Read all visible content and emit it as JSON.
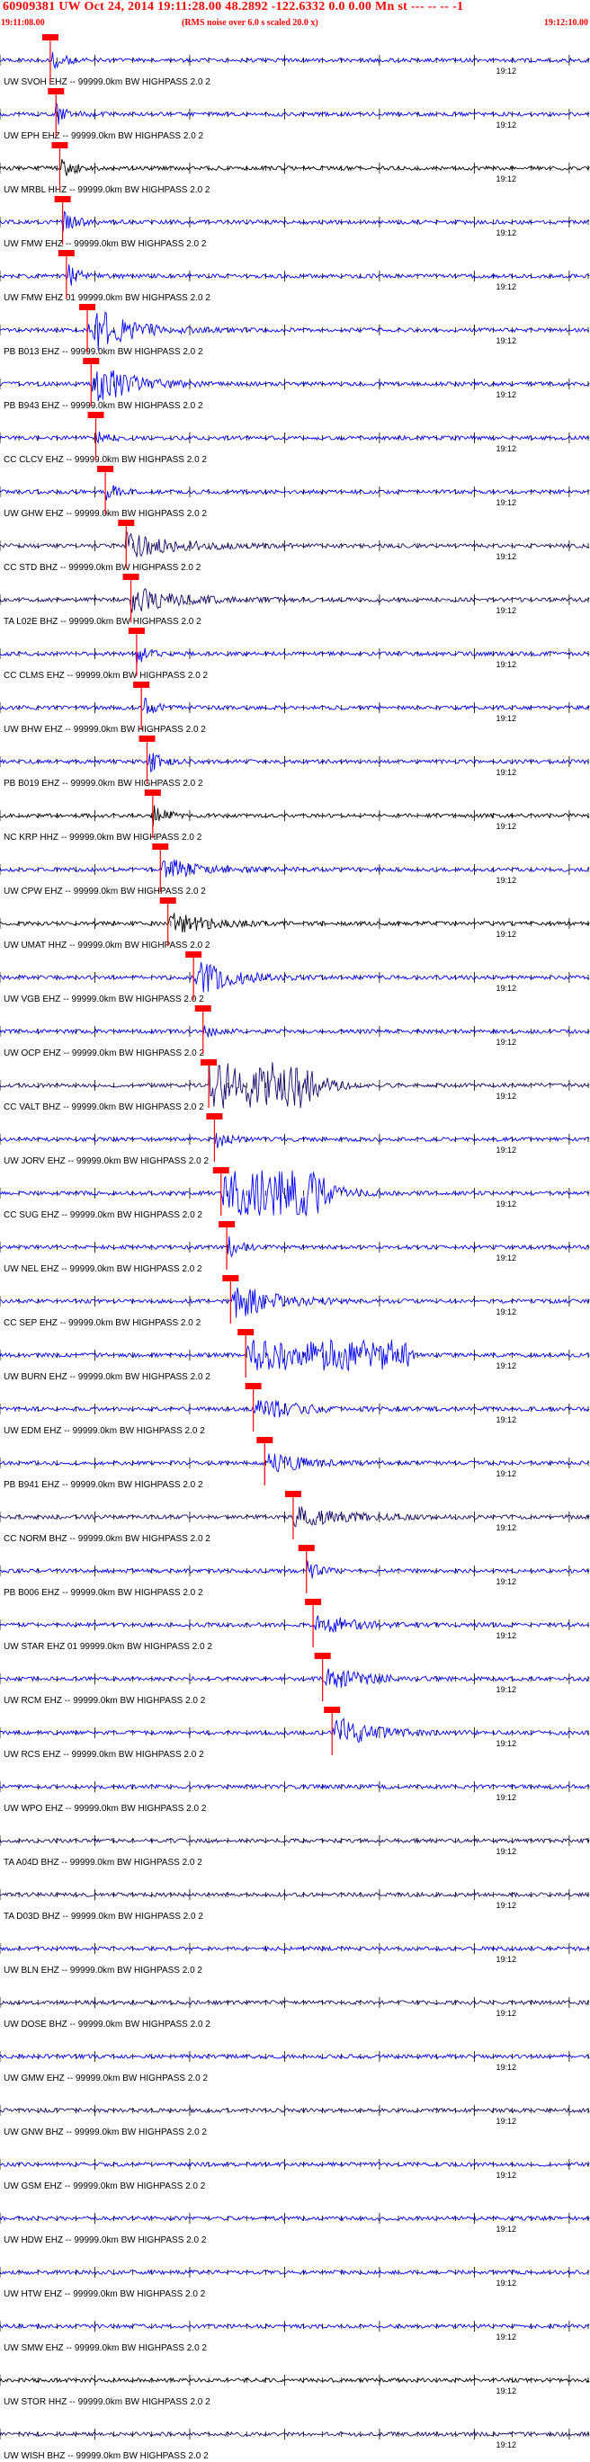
{
  "header": {
    "title": "60909381 UW Oct 24, 2014 19:11:28.00   48.2892  -122.6332  0.0 0.00 Mn st --- -- --  -1",
    "start_time": "19:11:08.00",
    "note": "(RMS noise over 6.0 s scaled 20.0 x)",
    "end_time": "19:12:10.00",
    "color": "#ff0000"
  },
  "chart_data": {
    "type": "seismogram-record-section",
    "time_range_s": [
      0,
      62
    ],
    "minute_tick_label": "19:12",
    "minute_tick_time_s": 52,
    "colors": {
      "trace_blue": "#0000ff",
      "trace_black": "#000000",
      "trace_navy": "#1a0a6e",
      "pick": "#ff0000",
      "tick": "#000000"
    },
    "traces": [
      {
        "label": "UW SVOH EHZ -- 99999.0km BW  HIGHPASS  2.0  2",
        "pick_s": 5.3,
        "color": "trace_blue",
        "amp": 1.5,
        "env": "pulse"
      },
      {
        "label": "UW EPH EHZ -- 99999.0km BW  HIGHPASS  2.0  2",
        "pick_s": 5.9,
        "color": "trace_blue",
        "amp": 1.3,
        "env": "pulse"
      },
      {
        "label": "UW MRBL HHZ -- 99999.0km BW  HIGHPASS  2.0  2",
        "pick_s": 6.3,
        "color": "trace_black",
        "amp": 1.6,
        "env": "pulse"
      },
      {
        "label": "UW FMW EHZ -- 99999.0km BW  HIGHPASS  2.0  2",
        "pick_s": 6.6,
        "color": "trace_blue",
        "amp": 1.4,
        "env": "pulse"
      },
      {
        "label": "UW FMW EHZ 01 99999.0km BW  HIGHPASS  2.0  2",
        "pick_s": 7.0,
        "color": "trace_blue",
        "amp": 1.5,
        "env": "pulse"
      },
      {
        "label": "PB B013 EHZ -- 99999.0km BW  HIGHPASS  2.0  2",
        "pick_s": 9.2,
        "color": "trace_blue",
        "amp": 3.5,
        "env": "burst"
      },
      {
        "label": "PB B943 EHZ -- 99999.0km BW  HIGHPASS  2.0  2",
        "pick_s": 9.6,
        "color": "trace_blue",
        "amp": 3.2,
        "env": "burst"
      },
      {
        "label": "CC CLCV EHZ -- 99999.0km BW  HIGHPASS  2.0  2",
        "pick_s": 10.1,
        "color": "trace_blue",
        "amp": 1.1,
        "env": "pulse"
      },
      {
        "label": "UW GHW EHZ -- 99999.0km BW  HIGHPASS  2.0  2",
        "pick_s": 11.1,
        "color": "trace_blue",
        "amp": 1.2,
        "env": "pulse"
      },
      {
        "label": "CC STD BHZ -- 99999.0km BW  HIGHPASS  2.0  2",
        "pick_s": 13.3,
        "color": "trace_navy",
        "amp": 2.0,
        "env": "coda"
      },
      {
        "label": "TA L02E BHZ -- 99999.0km BW  HIGHPASS  2.0  2",
        "pick_s": 13.8,
        "color": "trace_navy",
        "amp": 2.0,
        "env": "coda"
      },
      {
        "label": "CC CLMS EHZ -- 99999.0km BW  HIGHPASS  2.0  2",
        "pick_s": 14.4,
        "color": "trace_blue",
        "amp": 1.2,
        "env": "pulse"
      },
      {
        "label": "UW BHW EHZ -- 99999.0km BW  HIGHPASS  2.0  2",
        "pick_s": 14.9,
        "color": "trace_blue",
        "amp": 1.4,
        "env": "pulse"
      },
      {
        "label": "PB B019 EHZ -- 99999.0km BW  HIGHPASS  2.0  2",
        "pick_s": 15.5,
        "color": "trace_blue",
        "amp": 1.6,
        "env": "pulse"
      },
      {
        "label": "NC KRP HHZ -- 99999.0km BW  HIGHPASS  2.0  2",
        "pick_s": 16.1,
        "color": "trace_black",
        "amp": 1.4,
        "env": "pulse"
      },
      {
        "label": "UW CPW EHZ -- 99999.0km BW  HIGHPASS  2.0  2",
        "pick_s": 16.9,
        "color": "trace_blue",
        "amp": 1.6,
        "env": "burst"
      },
      {
        "label": "UW UMAT HHZ -- 99999.0km BW  HIGHPASS  2.0  2",
        "pick_s": 17.7,
        "color": "trace_black",
        "amp": 1.5,
        "env": "burst"
      },
      {
        "label": "UW VGB EHZ -- 99999.0km BW  HIGHPASS  2.0  2",
        "pick_s": 20.4,
        "color": "trace_blue",
        "amp": 2.4,
        "env": "burst"
      },
      {
        "label": "UW OCP EHZ -- 99999.0km BW  HIGHPASS  2.0  2",
        "pick_s": 21.4,
        "color": "trace_blue",
        "amp": 1.3,
        "env": "pulse"
      },
      {
        "label": "CC VALT BHZ -- 99999.0km BW  HIGHPASS  2.0  2",
        "pick_s": 22.0,
        "color": "trace_navy",
        "amp": 5.0,
        "env": "block"
      },
      {
        "label": "UW JORV EHZ -- 99999.0km BW  HIGHPASS  2.0  2",
        "pick_s": 22.6,
        "color": "trace_blue",
        "amp": 1.3,
        "env": "pulse"
      },
      {
        "label": "CC SUG EHZ -- 99999.0km BW  HIGHPASS  2.0  2",
        "pick_s": 23.3,
        "color": "trace_blue",
        "amp": 5.0,
        "env": "block"
      },
      {
        "label": "UW NEL EHZ -- 99999.0km BW  HIGHPASS  2.0  2",
        "pick_s": 23.9,
        "color": "trace_blue",
        "amp": 1.4,
        "env": "pulse"
      },
      {
        "label": "CC SEP EHZ -- 99999.0km BW  HIGHPASS  2.0  2",
        "pick_s": 24.3,
        "color": "trace_blue",
        "amp": 3.0,
        "env": "burst"
      },
      {
        "label": "UW BURN EHZ -- 99999.0km BW  HIGHPASS  2.0  2",
        "pick_s": 25.9,
        "color": "trace_blue",
        "amp": 6.5,
        "env": "saturated"
      },
      {
        "label": "UW EDM EHZ -- 99999.0km BW  HIGHPASS  2.0  2",
        "pick_s": 26.7,
        "color": "trace_blue",
        "amp": 1.8,
        "env": "burst"
      },
      {
        "label": "PB B941 EHZ -- 99999.0km BW  HIGHPASS  2.0  2",
        "pick_s": 27.9,
        "color": "trace_blue",
        "amp": 1.5,
        "env": "burst"
      },
      {
        "label": "CC NORM BHZ -- 99999.0km BW  HIGHPASS  2.0  2",
        "pick_s": 30.9,
        "color": "trace_navy",
        "amp": 1.6,
        "env": "coda"
      },
      {
        "label": "PB B006 EHZ -- 99999.0km BW  HIGHPASS  2.0  2",
        "pick_s": 32.3,
        "color": "trace_blue",
        "amp": 1.4,
        "env": "pulse"
      },
      {
        "label": "UW STAR EHZ 01 99999.0km BW  HIGHPASS  2.0  2",
        "pick_s": 33.0,
        "color": "trace_blue",
        "amp": 1.5,
        "env": "burst"
      },
      {
        "label": "UW RCM EHZ -- 99999.0km BW  HIGHPASS  2.0  2",
        "pick_s": 34.0,
        "color": "trace_blue",
        "amp": 1.8,
        "env": "burst"
      },
      {
        "label": "UW RCS EHZ -- 99999.0km BW  HIGHPASS  2.0  2",
        "pick_s": 35.0,
        "color": "trace_blue",
        "amp": 2.2,
        "env": "burst"
      },
      {
        "label": "UW WPO EHZ -- 99999.0km BW  HIGHPASS  2.0  2",
        "pick_s": null,
        "color": "trace_blue",
        "amp": 1.0,
        "env": "noise"
      },
      {
        "label": "TA A04D BHZ -- 99999.0km BW  HIGHPASS  2.0  2",
        "pick_s": null,
        "color": "trace_navy",
        "amp": 1.0,
        "env": "noise"
      },
      {
        "label": "TA D03D BHZ -- 99999.0km BW  HIGHPASS  2.0  2",
        "pick_s": null,
        "color": "trace_navy",
        "amp": 1.0,
        "env": "noise"
      },
      {
        "label": "UW BLN EHZ -- 99999.0km BW  HIGHPASS  2.0  2",
        "pick_s": null,
        "color": "trace_blue",
        "amp": 1.0,
        "env": "noise"
      },
      {
        "label": "UW DOSE BHZ -- 99999.0km BW  HIGHPASS  2.0  2",
        "pick_s": null,
        "color": "trace_navy",
        "amp": 1.0,
        "env": "noise"
      },
      {
        "label": "UW GMW EHZ -- 99999.0km BW  HIGHPASS  2.0  2",
        "pick_s": null,
        "color": "trace_blue",
        "amp": 1.0,
        "env": "noise"
      },
      {
        "label": "UW GNW BHZ -- 99999.0km BW  HIGHPASS  2.0  2",
        "pick_s": null,
        "color": "trace_navy",
        "amp": 1.0,
        "env": "noise"
      },
      {
        "label": "UW GSM EHZ -- 99999.0km BW  HIGHPASS  2.0  2",
        "pick_s": null,
        "color": "trace_blue",
        "amp": 1.0,
        "env": "noise"
      },
      {
        "label": "UW HDW EHZ -- 99999.0km BW  HIGHPASS  2.0  2",
        "pick_s": null,
        "color": "trace_blue",
        "amp": 1.0,
        "env": "noise"
      },
      {
        "label": "UW HTW EHZ -- 99999.0km BW  HIGHPASS  2.0  2",
        "pick_s": null,
        "color": "trace_blue",
        "amp": 1.0,
        "env": "noise"
      },
      {
        "label": "UW SMW EHZ -- 99999.0km BW  HIGHPASS  2.0  2",
        "pick_s": null,
        "color": "trace_blue",
        "amp": 1.0,
        "env": "noise"
      },
      {
        "label": "UW STOR HHZ -- 99999.0km BW  HIGHPASS  2.0  2",
        "pick_s": null,
        "color": "trace_black",
        "amp": 1.0,
        "env": "noise"
      },
      {
        "label": "UW WISH BHZ -- 99999.0km BW  HIGHPASS  2.0  2",
        "pick_s": null,
        "color": "trace_navy",
        "amp": 1.0,
        "env": "noise"
      }
    ]
  }
}
